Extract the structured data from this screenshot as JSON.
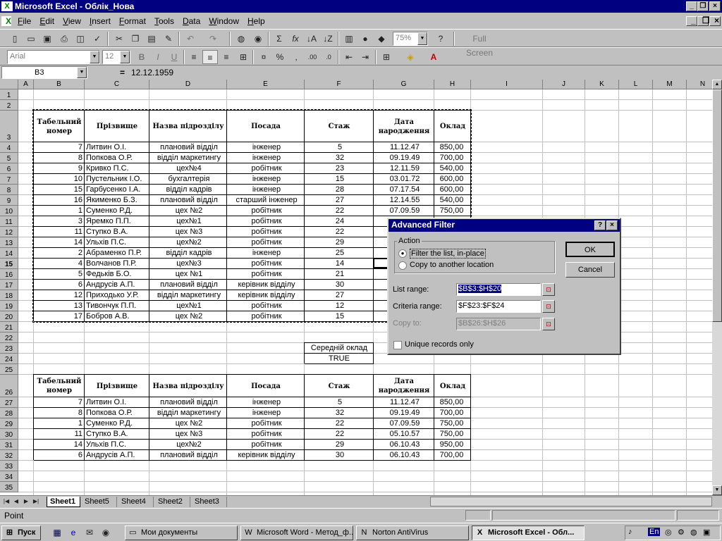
{
  "window": {
    "title": "Microsoft Excel - Облік_Нова"
  },
  "menu": [
    "File",
    "Edit",
    "View",
    "Insert",
    "Format",
    "Tools",
    "Data",
    "Window",
    "Help"
  ],
  "toolbar": {
    "zoom": "75%",
    "fullscreen": "Full Screen",
    "font": "Arial",
    "size": "12"
  },
  "formula": {
    "cell": "B3",
    "eq": "=",
    "value": "12.12.1959"
  },
  "columns": [
    "A",
    "B",
    "C",
    "D",
    "E",
    "F",
    "G",
    "H",
    "I",
    "J",
    "K",
    "L",
    "M",
    "N"
  ],
  "headers": [
    "Табельний номер",
    "Прізвище",
    "Назва підрозділу",
    "Посада",
    "Стаж",
    "Дата народження",
    "Оклад"
  ],
  "main_rows": [
    [
      "7",
      "Литвин О.І.",
      "плановий відділ",
      "інженер",
      "5",
      "11.12.47",
      "850,00"
    ],
    [
      "8",
      "Попкова О.Р.",
      "відділ маркетингу",
      "інженер",
      "32",
      "09.19.49",
      "700,00"
    ],
    [
      "9",
      "Кривко П.С.",
      "цех№4",
      "робітник",
      "23",
      "12.11.59",
      "540,00"
    ],
    [
      "10",
      "Пустельник І.О.",
      "бухгалтерія",
      "інженер",
      "15",
      "03.01.72",
      "600,00"
    ],
    [
      "15",
      "Гарбусенко І.А.",
      "відділ кадрів",
      "інженер",
      "28",
      "07.17.54",
      "600,00"
    ],
    [
      "16",
      "Якименко Б.З.",
      "плановий відділ",
      "старший інженер",
      "27",
      "12.14.55",
      "540,00"
    ],
    [
      "1",
      "Суменко Р.Д.",
      "цех №2",
      "робітник",
      "22",
      "07.09.59",
      "750,00"
    ],
    [
      "3",
      "Яремко П.П.",
      "цех№1",
      "робітник",
      "24",
      "",
      ""
    ],
    [
      "11",
      "Ступко В.А.",
      "цех №3",
      "робітник",
      "22",
      "",
      ""
    ],
    [
      "14",
      "Ульхів П.С.",
      "цех№2",
      "робітник",
      "29",
      "",
      ""
    ],
    [
      "2",
      "Абраменко П.Р.",
      "відділ кадрів",
      "інженер",
      "25",
      "",
      ""
    ],
    [
      "4",
      "Волчанов П.Р.",
      "цех№3",
      "робітник",
      "14",
      "",
      ""
    ],
    [
      "5",
      "Федьків Б.О.",
      "цех №1",
      "робітник",
      "21",
      "",
      ""
    ],
    [
      "6",
      "Андрусів А.П.",
      "плановий відділ",
      "керівник відділу",
      "30",
      "",
      ""
    ],
    [
      "12",
      "Приходько У.Р.",
      "відділ маркетингу",
      "керівник відділу",
      "27",
      "",
      ""
    ],
    [
      "13",
      "Тивончук П.П.",
      "цех№1",
      "робітник",
      "12",
      "",
      ""
    ],
    [
      "17",
      "Бобров А.В.",
      "цех №2",
      "робітник",
      "15",
      "",
      ""
    ]
  ],
  "criteria": {
    "header": "Середній оклад",
    "value": "TRUE"
  },
  "result_rows": [
    [
      "7",
      "Литвин О.І.",
      "плановий відділ",
      "інженер",
      "5",
      "11.12.47",
      "850,00"
    ],
    [
      "8",
      "Попкова О.Р.",
      "відділ маркетингу",
      "інженер",
      "32",
      "09.19.49",
      "700,00"
    ],
    [
      "1",
      "Суменко Р.Д.",
      "цех №2",
      "робітник",
      "22",
      "07.09.59",
      "750,00"
    ],
    [
      "11",
      "Ступко В.А.",
      "цех №3",
      "робітник",
      "22",
      "05.10.57",
      "750,00"
    ],
    [
      "14",
      "Ульхів П.С.",
      "цех№2",
      "робітник",
      "29",
      "06.10.43",
      "950,00"
    ],
    [
      "6",
      "Андрусів А.П.",
      "плановий відділ",
      "керівник відділу",
      "30",
      "06.10.43",
      "700,00"
    ]
  ],
  "sheets": [
    "Sheet1",
    "Sheet5",
    "Sheet4",
    "Sheet2",
    "Sheet3"
  ],
  "status": "Point",
  "dialog": {
    "title": "Advanced Filter",
    "action_label": "Action",
    "opt1": "Filter the list, in-place",
    "opt2": "Copy to another location",
    "ok": "OK",
    "cancel": "Cancel",
    "list_label": "List range:",
    "list_value": "$B$3:$H$20",
    "crit_label": "Criteria range:",
    "crit_value": "$F$23:$F$24",
    "copy_label": "Copy to:",
    "copy_value": "$B$26:$H$26",
    "unique": "Unique records only"
  },
  "taskbar": {
    "start": "Пуск",
    "tasks": [
      "Мои документы",
      "Microsoft Word - Метод_ф...",
      "Norton AntiVirus",
      "Microsoft Excel - Обл..."
    ],
    "lang": "En"
  }
}
